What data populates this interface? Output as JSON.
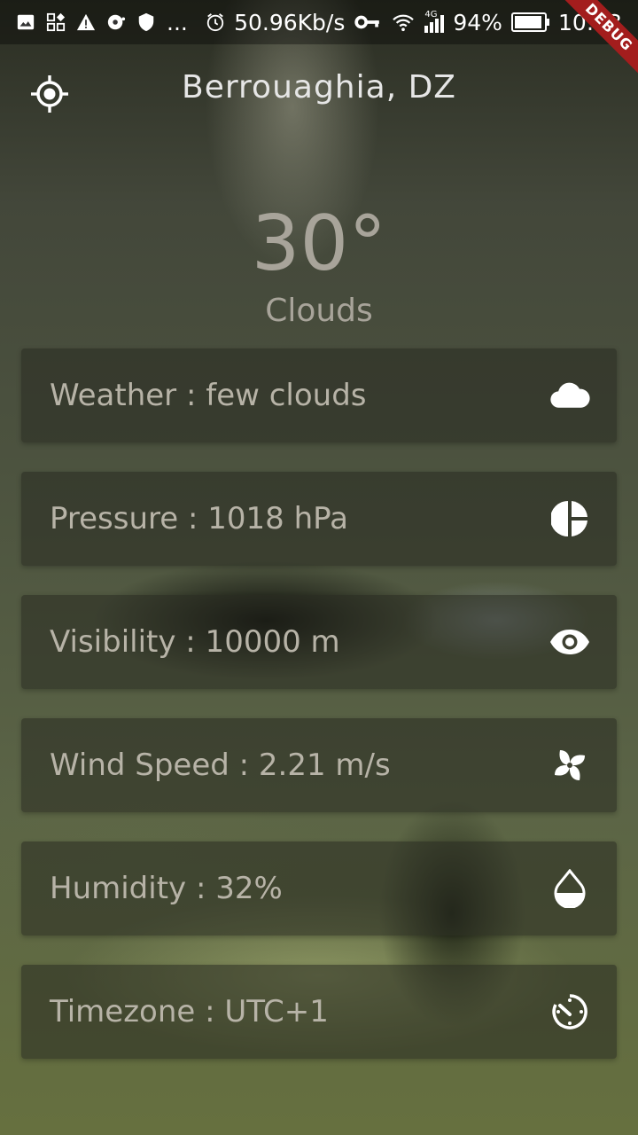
{
  "status_bar": {
    "network_speed": "50.96Kb/s",
    "network_type": "4G",
    "battery": "94%",
    "time": "10:43",
    "more": "..."
  },
  "debug_banner": "DEBUG",
  "header": {
    "location_icon": "my-location-icon",
    "city": "Berrouaghia, DZ"
  },
  "current": {
    "temperature": "30°",
    "condition": "Clouds"
  },
  "details": [
    {
      "label": "Weather : few clouds",
      "icon": "cloud-icon"
    },
    {
      "label": "Pressure : 1018 hPa",
      "icon": "pie-chart-icon"
    },
    {
      "label": "Visibility : 10000 m",
      "icon": "eye-icon"
    },
    {
      "label": "Wind Speed : 2.21 m/s",
      "icon": "fan-icon"
    },
    {
      "label": "Humidity : 32%",
      "icon": "water-drop-icon"
    },
    {
      "label": "Timezone : UTC+1",
      "icon": "timer-icon"
    }
  ],
  "colors": {
    "primary_text": "#e6e6e6",
    "muted_text": "#a8a49a",
    "card_background": "rgba(40,42,32,0.55)",
    "debug_ribbon": "#a31d1d"
  }
}
